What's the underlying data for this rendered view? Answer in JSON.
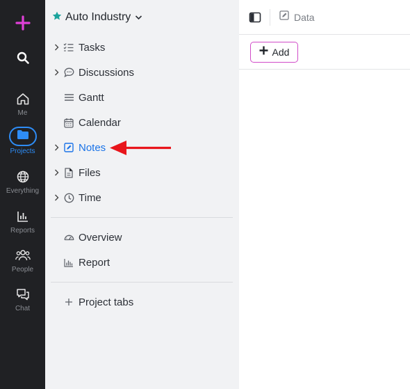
{
  "rail": {
    "items": [
      {
        "icon": "plus-icon",
        "label": ""
      },
      {
        "icon": "search-icon",
        "label": ""
      },
      {
        "icon": "home-icon",
        "label": "Me"
      },
      {
        "icon": "folder-icon",
        "label": "Projects"
      },
      {
        "icon": "globe-icon",
        "label": "Everything"
      },
      {
        "icon": "bar-chart-icon",
        "label": "Reports"
      },
      {
        "icon": "people-icon",
        "label": "People"
      },
      {
        "icon": "chat-icon",
        "label": "Chat"
      }
    ],
    "active": "Projects",
    "colors": {
      "accent": "#2e8df7",
      "plus": "#e040d8",
      "background": "#202124"
    }
  },
  "project": {
    "name": "Auto Industry",
    "star_color": "#1aa39c"
  },
  "nav": {
    "items": [
      {
        "label": "Tasks",
        "icon": "checklist-icon",
        "expandable": true
      },
      {
        "label": "Discussions",
        "icon": "speech-bubble-icon",
        "expandable": true
      },
      {
        "label": "Gantt",
        "icon": "gantt-icon",
        "expandable": false
      },
      {
        "label": "Calendar",
        "icon": "calendar-icon",
        "expandable": false
      },
      {
        "label": "Notes",
        "icon": "note-edit-icon",
        "expandable": true,
        "active": true
      },
      {
        "label": "Files",
        "icon": "file-icon",
        "expandable": true
      },
      {
        "label": "Time",
        "icon": "clock-icon",
        "expandable": true
      }
    ],
    "secondary": [
      {
        "label": "Overview",
        "icon": "gauge-icon"
      },
      {
        "label": "Report",
        "icon": "bar-chart-icon"
      }
    ],
    "add_tabs_label": "Project tabs",
    "active_color": "#1a73e8"
  },
  "topbar": {
    "tab_label": "Data"
  },
  "toolbar": {
    "add_label": "Add",
    "add_border_color": "#d04bc8"
  },
  "annotation": {
    "arrow_color": "#e8151b",
    "points_to": "Notes"
  }
}
